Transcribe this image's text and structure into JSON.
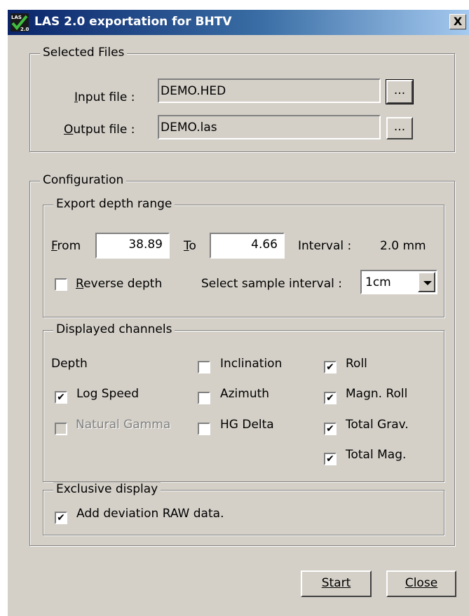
{
  "window": {
    "title": "LAS 2.0 exportation for BHTV",
    "close_glyph": "X",
    "app_icon": "las-checkmark-icon"
  },
  "selected_files": {
    "legend": "Selected Files",
    "input_label": "Input file :",
    "input_value": "DEMO.HED",
    "input_browse": "...",
    "output_label": "Output file :",
    "output_value": "DEMO.las",
    "output_browse": "..."
  },
  "configuration": {
    "legend": "Configuration",
    "depth_range": {
      "legend": "Export depth range",
      "from_label": "From",
      "from_value": "38.89",
      "to_label": "To",
      "to_value": "4.66",
      "interval_label": "Interval :",
      "interval_value": "2.0 mm",
      "reverse_label": "Reverse depth",
      "reverse_checked": false,
      "sample_label": "Select sample interval :",
      "sample_value": "1cm"
    },
    "channels": {
      "legend": "Displayed channels",
      "depth_label": "Depth",
      "items": [
        {
          "label": "Log Speed",
          "checked": true,
          "enabled": true
        },
        {
          "label": "Natural Gamma",
          "checked": false,
          "enabled": false
        },
        {
          "label": "Inclination",
          "checked": false,
          "enabled": true
        },
        {
          "label": "Azimuth",
          "checked": false,
          "enabled": true
        },
        {
          "label": "HG Delta",
          "checked": false,
          "enabled": true
        },
        {
          "label": "Roll",
          "checked": true,
          "enabled": true
        },
        {
          "label": "Magn. Roll",
          "checked": true,
          "enabled": true
        },
        {
          "label": "Total Grav.",
          "checked": true,
          "enabled": true
        },
        {
          "label": "Total Mag.",
          "checked": true,
          "enabled": true
        }
      ]
    },
    "exclusive": {
      "legend": "Exclusive display",
      "raw_label": "Add deviation RAW data.",
      "raw_checked": true
    }
  },
  "buttons": {
    "start": "Start",
    "close": "Close"
  },
  "check_glyph": "✔"
}
